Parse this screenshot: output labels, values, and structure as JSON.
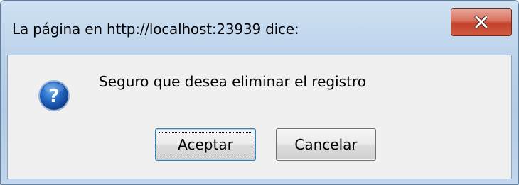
{
  "dialog": {
    "title": "La página en http://localhost:23939 dice:",
    "message": "Seguro que desea eliminar el registro",
    "icon": "question-icon",
    "close_icon": "close-icon",
    "buttons": {
      "accept_label": "Aceptar",
      "cancel_label": "Cancelar"
    },
    "colors": {
      "close_button": "#c7432d",
      "question_icon": "#1f5fb8",
      "focus_border": "#3c7fb1"
    }
  }
}
